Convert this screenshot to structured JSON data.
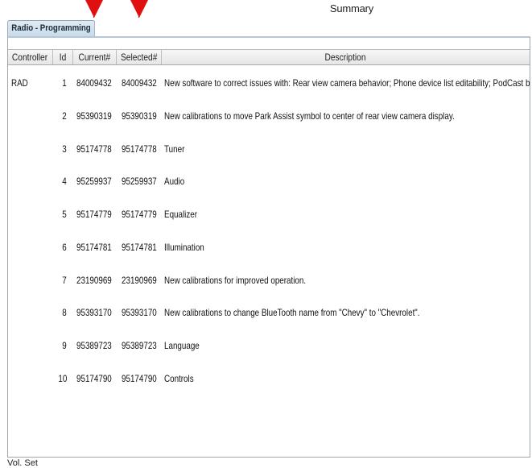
{
  "window": {
    "title": "Summary"
  },
  "tabs": [
    {
      "label": "Radio - Programming"
    }
  ],
  "table": {
    "columns": [
      "Controller",
      "Id",
      "Current#",
      "Selected#",
      "Description"
    ],
    "rows": [
      {
        "controller": "RAD",
        "id": "1",
        "current": "84009432",
        "selected": "84009432",
        "description": "New software to correct issues with: Rear view camera behavior; Phone device list editability; PodCast behavior"
      },
      {
        "controller": "",
        "id": "2",
        "current": "95390319",
        "selected": "95390319",
        "description": "New calibrations to move Park Assist symbol to center of rear view camera display."
      },
      {
        "controller": "",
        "id": "3",
        "current": "95174778",
        "selected": "95174778",
        "description": "Tuner"
      },
      {
        "controller": "",
        "id": "4",
        "current": "95259937",
        "selected": "95259937",
        "description": "Audio"
      },
      {
        "controller": "",
        "id": "5",
        "current": "95174779",
        "selected": "95174779",
        "description": "Equalizer"
      },
      {
        "controller": "",
        "id": "6",
        "current": "95174781",
        "selected": "95174781",
        "description": "Illumination"
      },
      {
        "controller": "",
        "id": "7",
        "current": "23190969",
        "selected": "23190969",
        "description": "New calibrations for improved operation."
      },
      {
        "controller": "",
        "id": "8",
        "current": "95393170",
        "selected": "95393170",
        "description": "New calibrations to change BlueTooth name from \"Chevy\" to \"Chevrolet\"."
      },
      {
        "controller": "",
        "id": "9",
        "current": "95389723",
        "selected": "95389723",
        "description": "Language"
      },
      {
        "controller": "",
        "id": "10",
        "current": "95174790",
        "selected": "95174790",
        "description": "Controls"
      }
    ]
  },
  "footer": {
    "text": "Vol. Set"
  },
  "colors": {
    "arrow": "#e01010",
    "tab_bg": "#c9dbe9",
    "header_bg": "#e6e6e6"
  }
}
